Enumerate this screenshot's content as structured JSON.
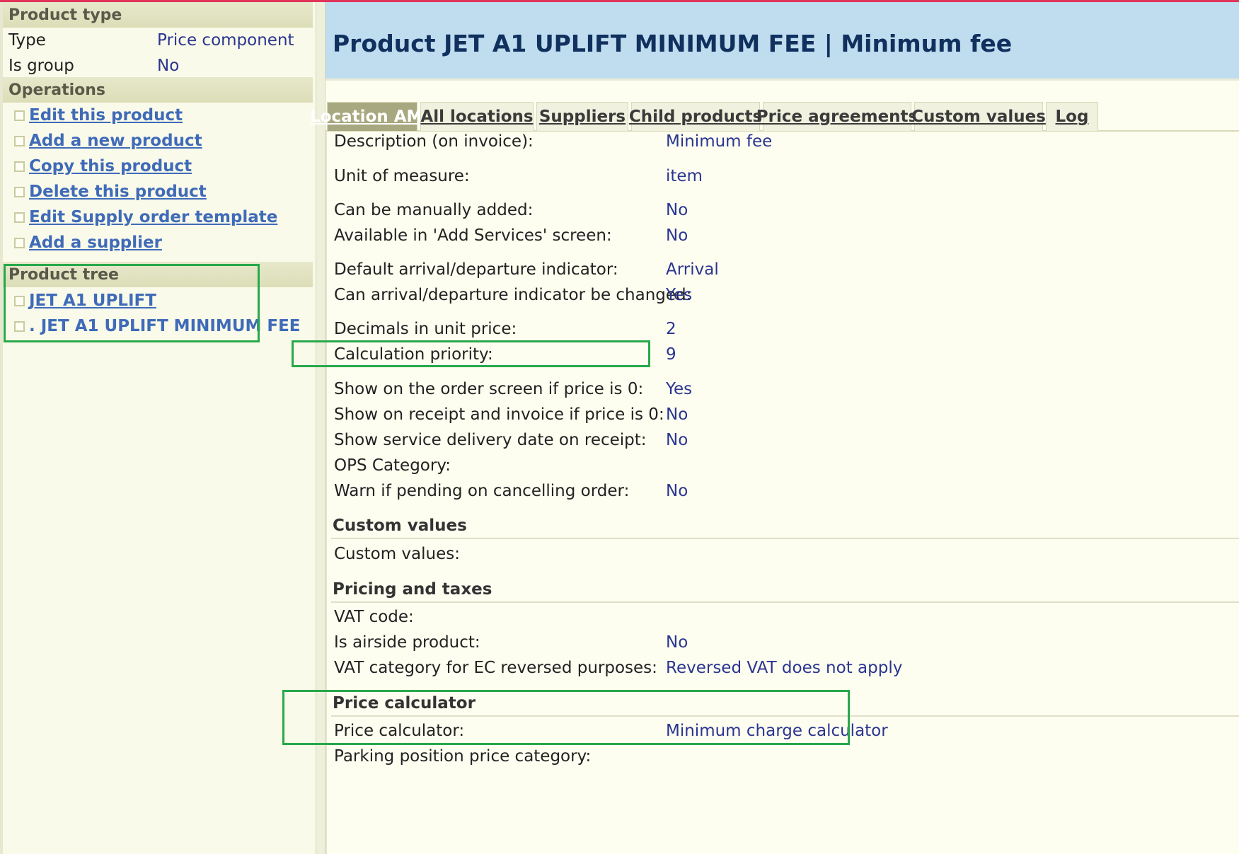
{
  "sidebar": {
    "product_type": {
      "header": "Product type",
      "rows": [
        {
          "label": "Type",
          "value": "Price component"
        },
        {
          "label": "Is group",
          "value": "No"
        }
      ]
    },
    "operations": {
      "header": "Operations",
      "items": [
        {
          "label": "Edit this product"
        },
        {
          "label": "Add a new product"
        },
        {
          "label": "Copy this product"
        },
        {
          "label": "Delete this product"
        },
        {
          "label": "Edit Supply order template"
        },
        {
          "label": "Add a supplier"
        }
      ]
    },
    "product_tree": {
      "header": "Product tree",
      "items": [
        {
          "label": "JET A1 UPLIFT"
        },
        {
          "label": ". JET A1 UPLIFT MINIMUM FEE"
        }
      ]
    }
  },
  "main": {
    "title": "Product JET A1 UPLIFT MINIMUM FEE | Minimum fee",
    "tabs": [
      {
        "label": "Location AMS",
        "active": true
      },
      {
        "label": "All locations"
      },
      {
        "label": "Suppliers"
      },
      {
        "label": "Child products"
      },
      {
        "label": "Price agreements"
      },
      {
        "label": "Custom values"
      },
      {
        "label": "Log"
      }
    ],
    "fields": [
      {
        "label": "Description (on invoice):",
        "value": "Minimum fee"
      },
      {
        "label": "Unit of measure:",
        "value": "item"
      },
      {
        "label": "Can be manually added:",
        "value": "No"
      },
      {
        "label": "Available in 'Add Services' screen:",
        "value": "No"
      },
      {
        "label": "Default arrival/departure indicator:",
        "value": "Arrival"
      },
      {
        "label": "Can arrival/departure indicator be changed:",
        "value": "Yes"
      },
      {
        "label": "Decimals in unit price:",
        "value": "2"
      },
      {
        "label": "Calculation priority:",
        "value": "9"
      },
      {
        "label": "Show on the order screen if price is 0:",
        "value": "Yes"
      },
      {
        "label": "Show on receipt and invoice if price is 0:",
        "value": "No"
      },
      {
        "label": "Show service delivery date on receipt:",
        "value": "No"
      },
      {
        "label": "OPS Category:",
        "value": ""
      },
      {
        "label": "Warn if pending on cancelling order:",
        "value": "No"
      }
    ],
    "groups": {
      "custom_values": {
        "title": "Custom values",
        "fields": [
          {
            "label": "Custom values:",
            "value": ""
          }
        ]
      },
      "pricing_and_taxes": {
        "title": "Pricing and taxes",
        "fields": [
          {
            "label": "VAT code:",
            "value": ""
          },
          {
            "label": "Is airside product:",
            "value": "No"
          },
          {
            "label": "VAT category for EC reversed purposes:",
            "value": "Reversed VAT does not apply"
          }
        ]
      },
      "price_calculator": {
        "title": "Price calculator",
        "fields": [
          {
            "label": "Price calculator:",
            "value": "Minimum charge calculator"
          },
          {
            "label": "Parking position price category:",
            "value": ""
          }
        ]
      }
    }
  },
  "colors": {
    "accent_top": "#e0345a",
    "title_banner": "#c0dcef",
    "link": "#3f6bb8",
    "value": "#2a3590",
    "highlight_box": "#28a84a",
    "active_tab": "#a8a880"
  }
}
